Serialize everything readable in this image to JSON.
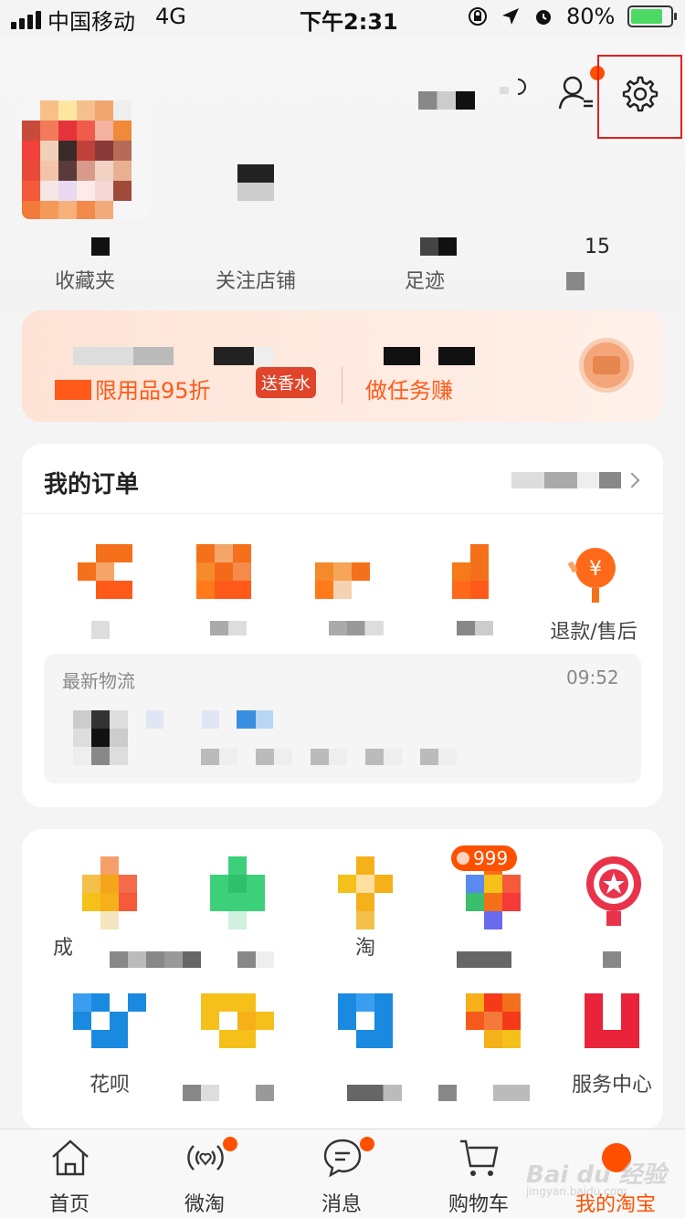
{
  "status_bar": {
    "carrier": "中国移动",
    "network": "4G",
    "time": "下午2:31",
    "battery": "80%",
    "battery_level": 0.8
  },
  "header": {
    "icons": [
      "scan-icon",
      "contacts-icon",
      "gear-icon"
    ],
    "settings_highlight_color": "#e02020"
  },
  "stats": {
    "items": [
      {
        "label": "收藏夹"
      },
      {
        "label": "关注店铺"
      },
      {
        "label": "足迹"
      },
      {
        "label": ""
      }
    ],
    "footprint_count": "15"
  },
  "vip": {
    "promo_text": "限用品95折",
    "badge": "送香水",
    "promo_text2": "做任务赚"
  },
  "orders": {
    "title": "我的订单",
    "items": [
      {
        "label": ""
      },
      {
        "label": ""
      },
      {
        "label": ""
      },
      {
        "label": ""
      },
      {
        "label": "退款/售后"
      }
    ],
    "logistics": {
      "title": "最新物流",
      "time": "09:52"
    }
  },
  "tools": {
    "row1": [
      {
        "label": "成"
      },
      {
        "label": ""
      },
      {
        "label": "淘"
      },
      {
        "label": "",
        "badge": "999"
      },
      {
        "label": ""
      }
    ],
    "row2": [
      {
        "label": "花呗"
      },
      {
        "label": ""
      },
      {
        "label": ""
      },
      {
        "label": ""
      },
      {
        "label": "服务中心"
      }
    ]
  },
  "tabbar": {
    "tabs": [
      {
        "label": "首页",
        "icon": "home-icon"
      },
      {
        "label": "微淘",
        "icon": "weitao-icon"
      },
      {
        "label": "消息",
        "icon": "message-icon"
      },
      {
        "label": "购物车",
        "icon": "cart-icon"
      },
      {
        "label": "我的淘宝",
        "icon": "profile-icon"
      }
    ],
    "accent": "#ff5000"
  },
  "watermark": {
    "text": "Bai du 经验",
    "subtext": "jingyan.baidu.com"
  }
}
